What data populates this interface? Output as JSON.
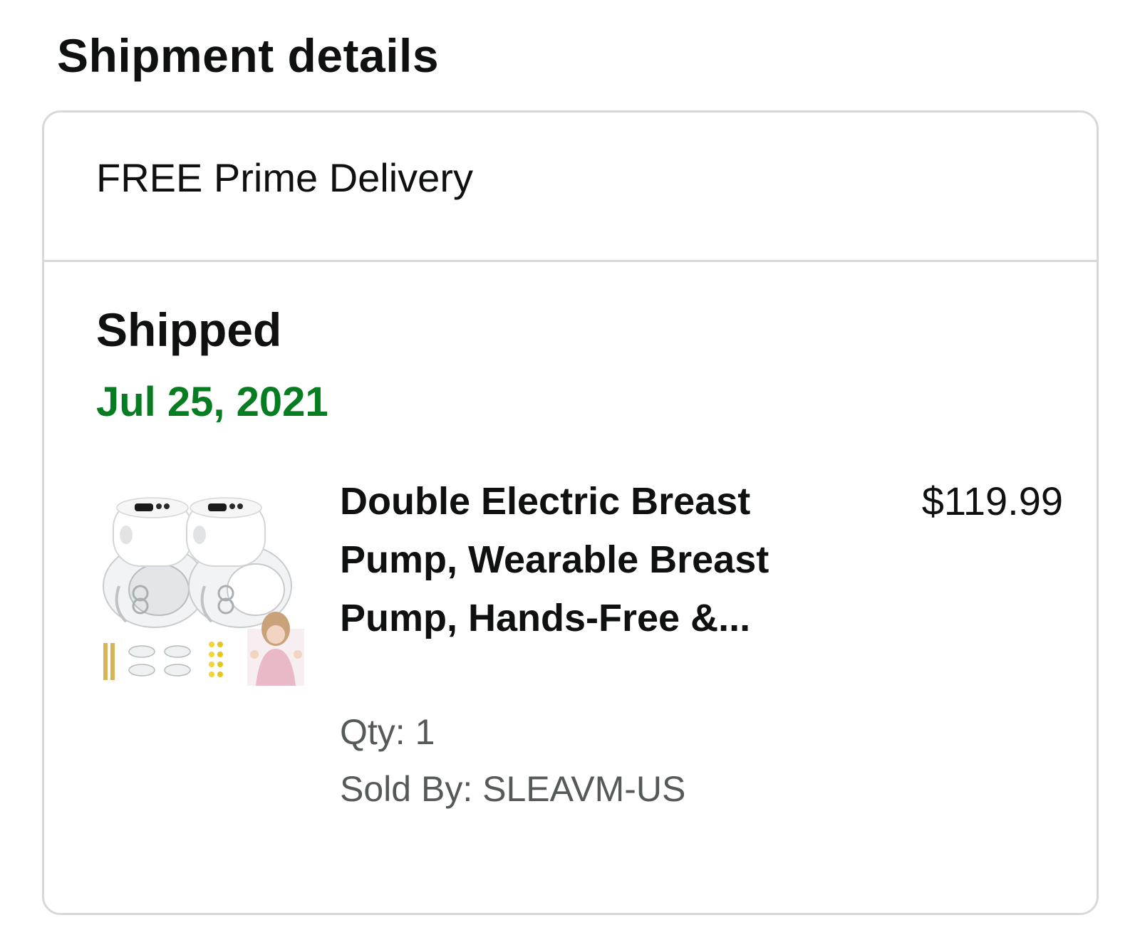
{
  "section": {
    "title": "Shipment details"
  },
  "shipment": {
    "delivery_label": "FREE Prime Delivery",
    "status": "Shipped",
    "date": "Jul 25, 2021",
    "status_date_color": "#067d21",
    "item": {
      "title": "Double Electric Breast Pump, Wearable Breast Pump, Hands-Free &...",
      "price": "$119.99",
      "qty": "Qty: 1",
      "sold_by": "Sold By: SLEAVM-US",
      "thumbnail_icon": "product-thumbnail-breast-pump"
    }
  }
}
